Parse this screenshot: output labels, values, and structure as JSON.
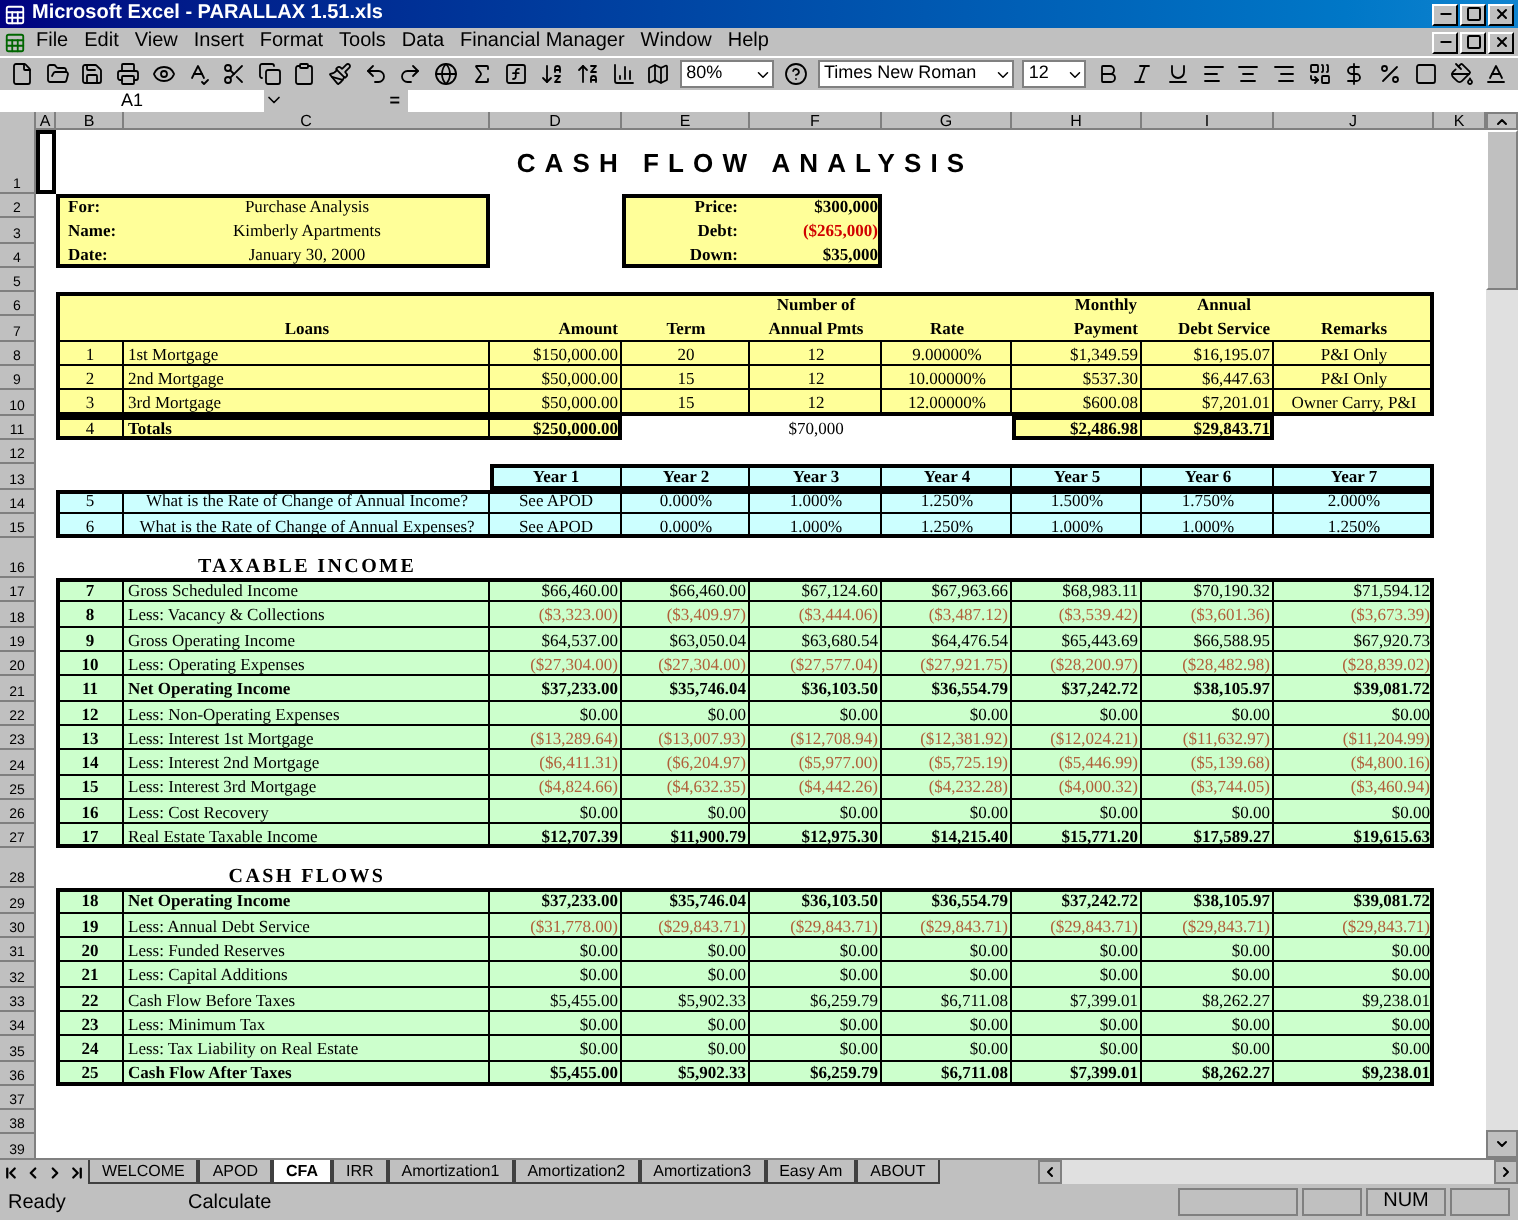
{
  "window": {
    "title": "Microsoft Excel - PARALLAX 1.51.xls"
  },
  "menu": [
    "File",
    "Edit",
    "View",
    "Insert",
    "Format",
    "Tools",
    "Data",
    "Financial Manager",
    "Window",
    "Help"
  ],
  "toolbar": {
    "zoom": "80%",
    "font": "Times New Roman",
    "size": "12"
  },
  "formula_bar": {
    "name_box": "A1",
    "equals": "="
  },
  "column_headers": [
    "A",
    "B",
    "C",
    "D",
    "E",
    "F",
    "G",
    "H",
    "I",
    "J",
    "K"
  ],
  "row_numbers": [
    "1",
    "2",
    "3",
    "4",
    "5",
    "6",
    "7",
    "8",
    "9",
    "10",
    "11",
    "12",
    "13",
    "14",
    "15",
    "16",
    "17",
    "18",
    "19",
    "20",
    "21",
    "22",
    "23",
    "24",
    "25",
    "26",
    "27",
    "28",
    "29",
    "30",
    "31",
    "32",
    "33",
    "34",
    "35",
    "36",
    "37",
    "38",
    "39"
  ],
  "sheet": {
    "title": "CASH FLOW ANALYSIS",
    "info": [
      {
        "label": "For:",
        "value": "Purchase Analysis"
      },
      {
        "label": "Name:",
        "value": "Kimberly Apartments"
      },
      {
        "label": "Date:",
        "value": "January 30, 2000"
      }
    ],
    "price": [
      {
        "label": "Price:",
        "value": "$300,000",
        "negative": false
      },
      {
        "label": "Debt:",
        "value": "($265,000)",
        "negative": true
      },
      {
        "label": "Down:",
        "value": "$35,000",
        "negative": false
      }
    ],
    "loans": {
      "columns": [
        "Loans",
        "Amount",
        "Term",
        "Number of\nAnnual Pmts",
        "Rate",
        "Monthly\nPayment",
        "Annual\nDebt Service",
        "Remarks"
      ],
      "rows": [
        {
          "num": "1",
          "name": "1st Mortgage",
          "amount": "$150,000.00",
          "term": "20",
          "payments": "12",
          "rate": "9.00000%",
          "monthly": "$1,349.59",
          "annual": "$16,195.07",
          "remarks": "P&I Only"
        },
        {
          "num": "2",
          "name": "2nd Mortgage",
          "amount": "$50,000.00",
          "term": "15",
          "payments": "12",
          "rate": "10.00000%",
          "monthly": "$537.30",
          "annual": "$6,447.63",
          "remarks": "P&I Only"
        },
        {
          "num": "3",
          "name": "3rd Mortgage",
          "amount": "$50,000.00",
          "term": "15",
          "payments": "12",
          "rate": "12.00000%",
          "monthly": "$600.08",
          "annual": "$7,201.01",
          "remarks": "Owner Carry, P&I"
        }
      ],
      "totals": {
        "num": "4",
        "label": "Totals",
        "amount": "$250,000.00",
        "payments_cell": "$70,000",
        "monthly": "$2,486.98",
        "annual": "$29,843.71"
      }
    },
    "rates": {
      "columns": [
        "Year 1",
        "Year 2",
        "Year 3",
        "Year 4",
        "Year 5",
        "Year 6",
        "Year 7"
      ],
      "rows": [
        {
          "num": "5",
          "question": "What is the Rate of Change of Annual Income?",
          "values": [
            "See APOD",
            "0.000%",
            "1.000%",
            "1.250%",
            "1.500%",
            "1.750%",
            "2.000%"
          ]
        },
        {
          "num": "6",
          "question": "What is the Rate of Change of Annual Expenses?",
          "values": [
            "See APOD",
            "0.000%",
            "1.000%",
            "1.250%",
            "1.000%",
            "1.000%",
            "1.250%"
          ]
        }
      ]
    },
    "taxable_income": {
      "heading": "TAXABLE INCOME",
      "rows": [
        {
          "num": "7",
          "label": "Gross Scheduled Income",
          "bold_label": false,
          "bold_values": false,
          "negative": false,
          "values": [
            "$66,460.00",
            "$66,460.00",
            "$67,124.60",
            "$67,963.66",
            "$68,983.11",
            "$70,190.32",
            "$71,594.12"
          ]
        },
        {
          "num": "8",
          "label": "Less: Vacancy & Collections",
          "bold_label": false,
          "bold_values": false,
          "negative": true,
          "values": [
            "($3,323.00)",
            "($3,409.97)",
            "($3,444.06)",
            "($3,487.12)",
            "($3,539.42)",
            "($3,601.36)",
            "($3,673.39)"
          ]
        },
        {
          "num": "9",
          "label": "Gross Operating Income",
          "bold_label": false,
          "bold_values": false,
          "negative": false,
          "values": [
            "$64,537.00",
            "$63,050.04",
            "$63,680.54",
            "$64,476.54",
            "$65,443.69",
            "$66,588.95",
            "$67,920.73"
          ]
        },
        {
          "num": "10",
          "label": "Less: Operating Expenses",
          "bold_label": false,
          "bold_values": false,
          "negative": true,
          "values": [
            "($27,304.00)",
            "($27,304.00)",
            "($27,577.04)",
            "($27,921.75)",
            "($28,200.97)",
            "($28,482.98)",
            "($28,839.02)"
          ]
        },
        {
          "num": "11",
          "label": "Net Operating Income",
          "bold_label": true,
          "bold_values": true,
          "negative": false,
          "values": [
            "$37,233.00",
            "$35,746.04",
            "$36,103.50",
            "$36,554.79",
            "$37,242.72",
            "$38,105.97",
            "$39,081.72"
          ]
        },
        {
          "num": "12",
          "label": "Less: Non-Operating Expenses",
          "bold_label": false,
          "bold_values": false,
          "negative": false,
          "values": [
            "$0.00",
            "$0.00",
            "$0.00",
            "$0.00",
            "$0.00",
            "$0.00",
            "$0.00"
          ]
        },
        {
          "num": "13",
          "label": "Less: Interest 1st Mortgage",
          "bold_label": false,
          "bold_values": false,
          "negative": true,
          "values": [
            "($13,289.64)",
            "($13,007.93)",
            "($12,708.94)",
            "($12,381.92)",
            "($12,024.21)",
            "($11,632.97)",
            "($11,204.99)"
          ]
        },
        {
          "num": "14",
          "label": "Less: Interest 2nd Mortgage",
          "bold_label": false,
          "bold_values": false,
          "negative": true,
          "values": [
            "($6,411.31)",
            "($6,204.97)",
            "($5,977.00)",
            "($5,725.19)",
            "($5,446.99)",
            "($5,139.68)",
            "($4,800.16)"
          ]
        },
        {
          "num": "15",
          "label": "Less: Interest 3rd Mortgage",
          "bold_label": false,
          "bold_values": false,
          "negative": true,
          "values": [
            "($4,824.66)",
            "($4,632.35)",
            "($4,442.26)",
            "($4,232.28)",
            "($4,000.32)",
            "($3,744.05)",
            "($3,460.94)"
          ]
        },
        {
          "num": "16",
          "label": "Less: Cost Recovery",
          "bold_label": false,
          "bold_values": false,
          "negative": false,
          "values": [
            "$0.00",
            "$0.00",
            "$0.00",
            "$0.00",
            "$0.00",
            "$0.00",
            "$0.00"
          ]
        },
        {
          "num": "17",
          "label": "Real Estate Taxable Income",
          "bold_label": false,
          "bold_values": true,
          "negative": false,
          "values": [
            "$12,707.39",
            "$11,900.79",
            "$12,975.30",
            "$14,215.40",
            "$15,771.20",
            "$17,589.27",
            "$19,615.63"
          ]
        }
      ]
    },
    "cash_flows": {
      "heading": "CASH FLOWS",
      "rows": [
        {
          "num": "18",
          "label": "Net Operating Income",
          "bold_label": true,
          "bold_values": true,
          "negative": false,
          "values": [
            "$37,233.00",
            "$35,746.04",
            "$36,103.50",
            "$36,554.79",
            "$37,242.72",
            "$38,105.97",
            "$39,081.72"
          ]
        },
        {
          "num": "19",
          "label": "Less: Annual Debt Service",
          "bold_label": false,
          "bold_values": false,
          "negative": true,
          "values": [
            "($31,778.00)",
            "($29,843.71)",
            "($29,843.71)",
            "($29,843.71)",
            "($29,843.71)",
            "($29,843.71)",
            "($29,843.71)"
          ]
        },
        {
          "num": "20",
          "label": "Less: Funded Reserves",
          "bold_label": false,
          "bold_values": false,
          "negative": false,
          "values": [
            "$0.00",
            "$0.00",
            "$0.00",
            "$0.00",
            "$0.00",
            "$0.00",
            "$0.00"
          ]
        },
        {
          "num": "21",
          "label": "Less: Capital Additions",
          "bold_label": false,
          "bold_values": false,
          "negative": false,
          "values": [
            "$0.00",
            "$0.00",
            "$0.00",
            "$0.00",
            "$0.00",
            "$0.00",
            "$0.00"
          ]
        },
        {
          "num": "22",
          "label": "Cash Flow Before Taxes",
          "bold_label": false,
          "bold_values": false,
          "negative": false,
          "values": [
            "$5,455.00",
            "$5,902.33",
            "$6,259.79",
            "$6,711.08",
            "$7,399.01",
            "$8,262.27",
            "$9,238.01"
          ]
        },
        {
          "num": "23",
          "label": "Less: Minimum Tax",
          "bold_label": false,
          "bold_values": false,
          "negative": false,
          "values": [
            "$0.00",
            "$0.00",
            "$0.00",
            "$0.00",
            "$0.00",
            "$0.00",
            "$0.00"
          ]
        },
        {
          "num": "24",
          "label": "Less: Tax Liability on Real Estate",
          "bold_label": false,
          "bold_values": false,
          "negative": false,
          "values": [
            "$0.00",
            "$0.00",
            "$0.00",
            "$0.00",
            "$0.00",
            "$0.00",
            "$0.00"
          ]
        },
        {
          "num": "25",
          "label": "Cash Flow After Taxes",
          "bold_label": true,
          "bold_values": true,
          "negative": false,
          "values": [
            "$5,455.00",
            "$5,902.33",
            "$6,259.79",
            "$6,711.08",
            "$7,399.01",
            "$8,262.27",
            "$9,238.01"
          ]
        }
      ]
    }
  },
  "sheet_tabs": [
    {
      "label": "WELCOME",
      "selected": false
    },
    {
      "label": "APOD",
      "selected": false
    },
    {
      "label": "CFA",
      "selected": true
    },
    {
      "label": "IRR",
      "selected": false
    },
    {
      "label": "Amortization1",
      "selected": false
    },
    {
      "label": "Amortization2",
      "selected": false
    },
    {
      "label": "Amortization3",
      "selected": false
    },
    {
      "label": "Easy Am",
      "selected": false
    },
    {
      "label": "ABOUT",
      "selected": false
    }
  ],
  "status_bar": {
    "state": "Ready",
    "mode": "Calculate",
    "indicator": "NUM"
  }
}
